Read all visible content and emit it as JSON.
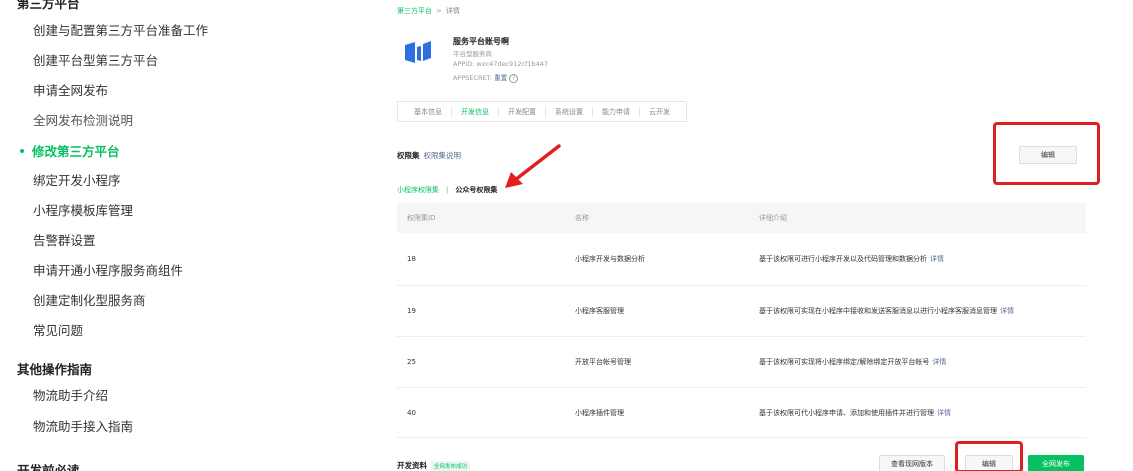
{
  "sidebar": {
    "section_top": "第三方平台",
    "items": [
      {
        "label": "创建与配置第三方平台准备工作"
      },
      {
        "label": "创建平台型第三方平台"
      },
      {
        "label": "申请全网发布"
      },
      {
        "label": "全网发布检测说明"
      },
      {
        "label": "修改第三方平台"
      },
      {
        "label": "绑定开发小程序"
      },
      {
        "label": "小程序模板库管理"
      },
      {
        "label": "告警群设置"
      },
      {
        "label": "申请开通小程序服务商组件"
      },
      {
        "label": "创建定制化型服务商"
      },
      {
        "label": "常见问题"
      }
    ],
    "section_other": "其他操作指南",
    "other_items": [
      {
        "label": "物流助手介绍"
      },
      {
        "label": "物流助手接入指南"
      }
    ],
    "section_bottom": "开发前必读"
  },
  "breadcrumb": {
    "root": "第三方平台",
    "sep": ">",
    "current": "详情"
  },
  "account": {
    "name": "服务平台账号啊",
    "type": "平台型服务商",
    "appid": "APPID: wxc47dec912cf1b447",
    "appsecret_label": "APPSECRET:",
    "reset_label": "重置",
    "help": "?"
  },
  "tabs": [
    {
      "label": "基本信息"
    },
    {
      "label": "开发信息"
    },
    {
      "label": "开发配置"
    },
    {
      "label": "系统设置"
    },
    {
      "label": "能力申请"
    },
    {
      "label": "云开发"
    }
  ],
  "permissions": {
    "title": "权限集",
    "link": "权限集说明",
    "edit_label": "编辑",
    "subtab_mini": "小程序权限集",
    "subtab_sep": "|",
    "subtab_official": "公众号权限集",
    "columns": [
      "权限集ID",
      "名称",
      "详细介绍"
    ],
    "rows": [
      {
        "id": "18",
        "name": "小程序开发与数据分析",
        "desc": "基于该权限可进行小程序开发以及代码管理和数据分析",
        "link": "详情"
      },
      {
        "id": "19",
        "name": "小程序客服管理",
        "desc": "基于该权限可实现在小程序中接收和发送客服消息以进行小程序客服消息管理",
        "link": "详情"
      },
      {
        "id": "25",
        "name": "开放平台帐号管理",
        "desc": "基于该权限可实现将小程序绑定/解除绑定开放平台帐号",
        "link": "详情"
      },
      {
        "id": "40",
        "name": "小程序插件管理",
        "desc": "基于该权限可代小程序申请、添加和使用插件并进行管理",
        "link": "详情"
      }
    ]
  },
  "dev_resources": {
    "title": "开发资料",
    "badge": "全网发布成功",
    "view_version": "查看现网版本",
    "edit_label": "编辑",
    "publish_label": "全网发布"
  },
  "colors": {
    "accent": "#07c160",
    "link": "#576b95",
    "highlight": "#e02020"
  }
}
